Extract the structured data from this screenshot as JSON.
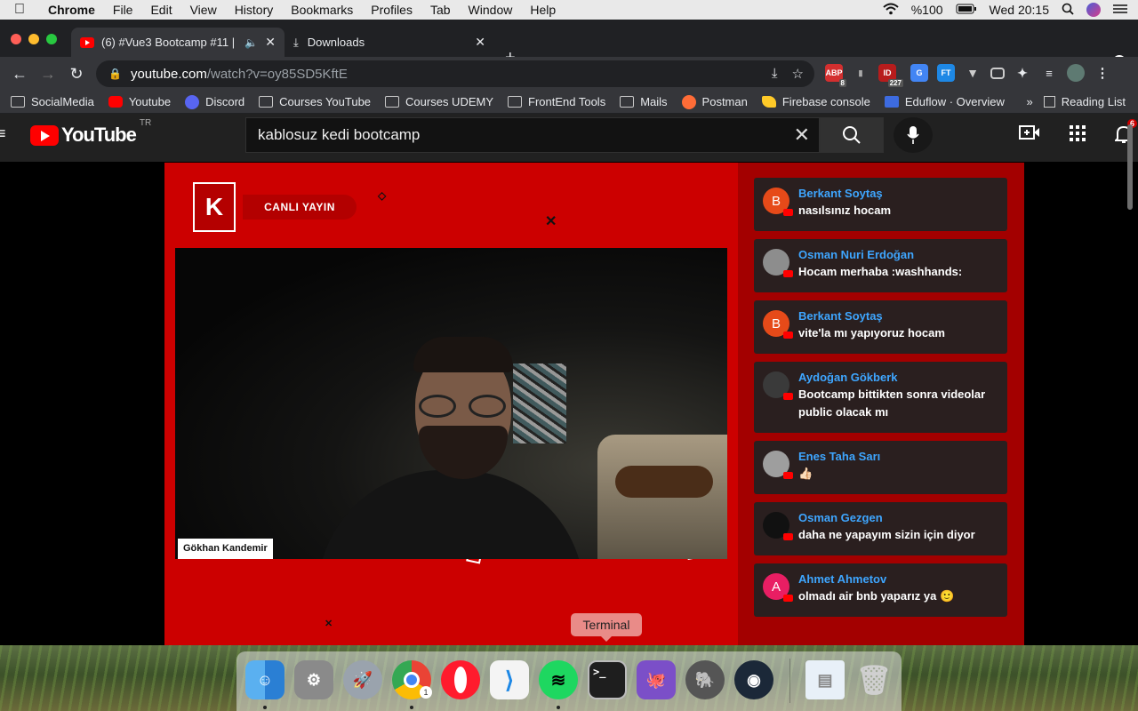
{
  "menubar": {
    "app": "Chrome",
    "items": [
      "File",
      "Edit",
      "View",
      "History",
      "Bookmarks",
      "Profiles",
      "Tab",
      "Window",
      "Help"
    ],
    "battery": "%100",
    "clock": "Wed 20:15"
  },
  "tabs": {
    "active_title": "(6) #Vue3 Bootcamp #11 |",
    "inactive_title": "Downloads"
  },
  "omnibox": {
    "host": "youtube.com",
    "path": "/watch?v=oy85SD5KftE"
  },
  "extensions": {
    "abp_count": "8",
    "ud_count": "227"
  },
  "bookmarks": {
    "items": [
      "SocialMedia",
      "Youtube",
      "Discord",
      "Courses YouTube",
      "Courses UDEMY",
      "FrontEnd Tools",
      "Mails",
      "Postman",
      "Firebase console",
      "Eduflow · Overview"
    ],
    "overflow": "»",
    "reading_list": "Reading List"
  },
  "youtube": {
    "logo_text": "YouTube",
    "country": "TR",
    "search_value": "kablosuz kedi bootcamp",
    "notification_count": "6"
  },
  "stream": {
    "logo_letter": "K",
    "live_label": "CANLI YAYIN",
    "presenter_name": "Gökhan Kandemir"
  },
  "chat": {
    "messages": [
      {
        "author": "Berkant Soytaş",
        "text": "nasılsınız hocam",
        "initial": "B",
        "color": "#e64a19"
      },
      {
        "author": "Osman Nuri Erdoğan",
        "text": "Hocam merhaba :washhands:",
        "initial": "",
        "color": "#8d8d8d"
      },
      {
        "author": "Berkant Soytaş",
        "text": "vite'la mı yapıyoruz hocam",
        "initial": "B",
        "color": "#e64a19"
      },
      {
        "author": "Aydoğan Gökberk",
        "text": "Bootcamp bittikten sonra videolar public olacak mı",
        "initial": "",
        "color": "#3a3a3a"
      },
      {
        "author": "Enes Taha Sarı",
        "text": "👍🏻",
        "initial": "",
        "color": "#9e9e9e"
      },
      {
        "author": "Osman Gezgen",
        "text": "daha ne yapayım sizin için diyor",
        "initial": "",
        "color": "#111111"
      },
      {
        "author": "Ahmet Ahmetov",
        "text": "olmadı air bnb yaparız ya 🙂",
        "initial": "A",
        "color": "#e91e63"
      }
    ]
  },
  "dock": {
    "tooltip": "Terminal",
    "chrome_badge": "1"
  }
}
